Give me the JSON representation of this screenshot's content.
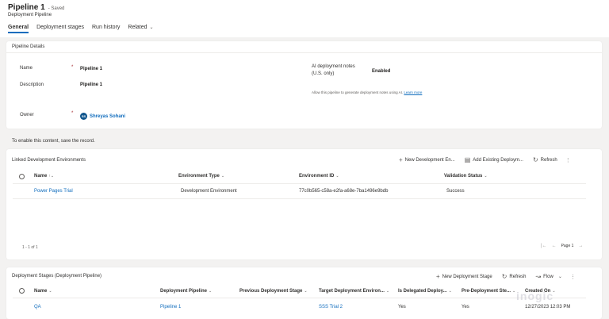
{
  "header": {
    "title": "Pipeline 1",
    "saved": "- Saved",
    "subtitle": "Deployment Pipeline",
    "tabs": [
      {
        "label": "General"
      },
      {
        "label": "Deployment stages"
      },
      {
        "label": "Run history"
      },
      {
        "label": "Related"
      }
    ]
  },
  "details": {
    "section_title": "Pipeline Details",
    "name_label": "Name",
    "name_value": "Pipeline 1",
    "description_label": "Description",
    "description_value": "Pipeline 1",
    "ai_label_line1": "AI deployment notes",
    "ai_label_line2": "(U.S. only)",
    "ai_value": "Enabled",
    "ai_hint": "Allow this pipeline to generate deployment notes using AI.",
    "ai_hint_link": "Learn more",
    "owner_label": "Owner",
    "owner_initials": "SS",
    "owner_name": "Shreyas Sohani",
    "required_marker": "*"
  },
  "notice": "To enable this content, save the record.",
  "linked": {
    "title": "Linked Development Environments",
    "commands": {
      "new": "New Development En...",
      "add_existing": "Add Existing Deploym...",
      "refresh": "Refresh"
    },
    "columns": [
      "Name",
      "Environment Type",
      "Environment ID",
      "Validation Status"
    ],
    "rows": [
      {
        "name": "Power Pages Trial",
        "type": "Development Environment",
        "id": "77c0b565-c58a-e2fa-a68e-7ba1496e9bdb",
        "status": "Success"
      }
    ],
    "pager": {
      "range": "1 - 1 of 1",
      "page": "Page 1"
    }
  },
  "stages": {
    "title": "Deployment Stages (Deployment Pipeline)",
    "commands": {
      "new": "New Deployment Stage",
      "refresh": "Refresh",
      "flow": "Flow"
    },
    "columns": [
      "Name",
      "Deployment Pipeline",
      "Previous Deployment Stage",
      "Target Deployment Environ...",
      "Is Delegated Deploy...",
      "Pre-Deployment Ste...",
      "Created On"
    ],
    "rows": [
      {
        "name": "QA",
        "pipeline": "Pipeline 1",
        "previous": "",
        "target": "SSS Trial 2",
        "delegated": "Yes",
        "pre_step": "Yes",
        "created": "12/27/2023 12:03 PM"
      }
    ]
  },
  "watermark": "inogic",
  "colors": {
    "accent": "#0f6cbd",
    "required": "#a4262c",
    "avatar": "#0f548c"
  }
}
